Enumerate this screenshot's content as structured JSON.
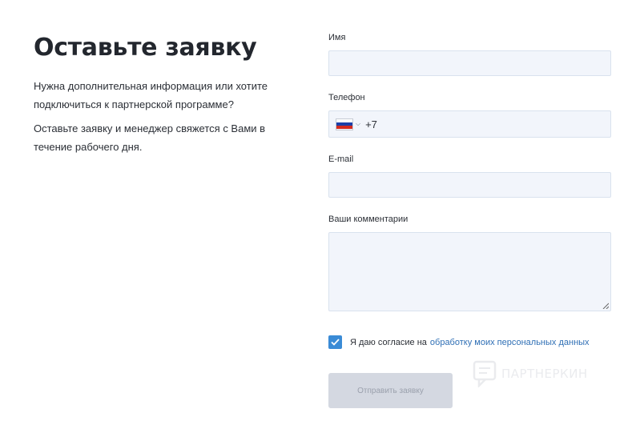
{
  "intro": {
    "title": "Оставьте заявку",
    "paragraph1": "Нужна дополнительная информация или хотите подключиться к партнерской программе?",
    "paragraph2": "Оставьте заявку и менеджер свяжется с Вами в течение рабочего дня."
  },
  "form": {
    "name_label": "Имя",
    "name_value": "",
    "phone_label": "Телефон",
    "phone_country": "ru-flag-icon",
    "phone_code": "+7",
    "email_label": "E-mail",
    "email_value": "",
    "comments_label": "Ваши комментарии",
    "comments_value": ""
  },
  "consent": {
    "checked": true,
    "text": "Я даю согласие на",
    "link_text": "обработку моих персональных данных"
  },
  "submit": {
    "label": "Отправить заявку"
  },
  "watermark": {
    "text": "ПАРТНЕРКИН"
  },
  "colors": {
    "accent": "#3a8bd6",
    "link": "#2f6fb5",
    "input_bg": "#f2f5fb",
    "button_disabled": "#d4d8e1"
  }
}
